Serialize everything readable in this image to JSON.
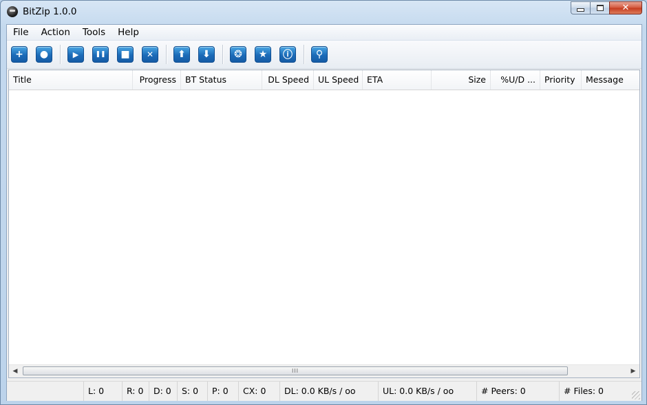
{
  "window": {
    "title": "BitZip 1.0.0",
    "caption_min": "minimize",
    "caption_max": "maximize",
    "caption_close": "✕"
  },
  "menu": [
    {
      "label": "File"
    },
    {
      "label": "Action"
    },
    {
      "label": "Tools"
    },
    {
      "label": "Help"
    }
  ],
  "toolbar": [
    {
      "name": "add-torrent",
      "icon": "plus-icon",
      "glyph": "+"
    },
    {
      "name": "add-url",
      "icon": "people-icon",
      "glyph": "●"
    },
    {
      "name": "start",
      "icon": "play-icon",
      "glyph": "▶"
    },
    {
      "name": "pause",
      "icon": "pause-icon",
      "glyph": "❚❚"
    },
    {
      "name": "stop",
      "icon": "stop-icon",
      "glyph": "■"
    },
    {
      "name": "remove",
      "icon": "x-icon",
      "glyph": "✕"
    },
    {
      "name": "move-up",
      "icon": "arrow-up-icon",
      "glyph": "⬆"
    },
    {
      "name": "move-down",
      "icon": "arrow-down-icon",
      "glyph": "⬇"
    },
    {
      "name": "network",
      "icon": "network-icon",
      "glyph": "❂"
    },
    {
      "name": "favorite",
      "icon": "star-icon",
      "glyph": "★"
    },
    {
      "name": "info",
      "icon": "info-icon",
      "glyph": "ⓘ"
    },
    {
      "name": "help",
      "icon": "pin-icon",
      "glyph": "⚲"
    }
  ],
  "columns": [
    {
      "label": "Title"
    },
    {
      "label": "Progress"
    },
    {
      "label": "BT Status"
    },
    {
      "label": "DL Speed"
    },
    {
      "label": "UL Speed"
    },
    {
      "label": "ETA"
    },
    {
      "label": "Size"
    },
    {
      "label": "%U/D ..."
    },
    {
      "label": "Priority"
    },
    {
      "label": "Message"
    }
  ],
  "scrollbar": {
    "left": "◀",
    "right": "▶",
    "thumb": "III"
  },
  "status": [
    {
      "label": ""
    },
    {
      "label": "L: 0"
    },
    {
      "label": "R: 0"
    },
    {
      "label": "D: 0"
    },
    {
      "label": "S: 0"
    },
    {
      "label": "P: 0"
    },
    {
      "label": "CX: 0"
    },
    {
      "label": "DL: 0.0 KB/s / oo"
    },
    {
      "label": "UL: 0.0 KB/s / oo"
    },
    {
      "label": "# Peers: 0"
    },
    {
      "label": "# Files: 0"
    }
  ],
  "colors": {
    "accent": "#1c6bb8",
    "titlebar": "#c4d9ee",
    "close": "#c43a1e"
  }
}
